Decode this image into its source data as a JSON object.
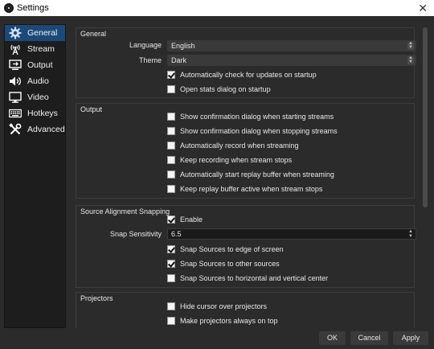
{
  "window": {
    "title": "Settings",
    "close_glyph": "✕",
    "app_icon": "obs-logo-icon"
  },
  "sidebar": {
    "items": [
      {
        "label": "General",
        "icon": "gear-icon",
        "active": true
      },
      {
        "label": "Stream",
        "icon": "broadcast-antenna-icon",
        "active": false
      },
      {
        "label": "Output",
        "icon": "output-icon",
        "active": false
      },
      {
        "label": "Audio",
        "icon": "speaker-icon",
        "active": false
      },
      {
        "label": "Video",
        "icon": "monitor-icon",
        "active": false
      },
      {
        "label": "Hotkeys",
        "icon": "keyboard-icon",
        "active": false
      },
      {
        "label": "Advanced",
        "icon": "tools-icon",
        "active": false
      }
    ]
  },
  "general": {
    "title": "General",
    "language_label": "Language",
    "language_value": "English",
    "theme_label": "Theme",
    "theme_value": "Dark",
    "auto_update_label": "Automatically check for updates on startup",
    "auto_update_checked": true,
    "stats_dialog_label": "Open stats dialog on startup",
    "stats_dialog_checked": false
  },
  "output": {
    "title": "Output",
    "options": [
      {
        "label": "Show confirmation dialog when starting streams",
        "checked": false
      },
      {
        "label": "Show confirmation dialog when stopping streams",
        "checked": false
      },
      {
        "label": "Automatically record when streaming",
        "checked": false
      },
      {
        "label": "Keep recording when stream stops",
        "checked": false
      },
      {
        "label": "Automatically start replay buffer when streaming",
        "checked": false
      },
      {
        "label": "Keep replay buffer active when stream stops",
        "checked": false
      }
    ]
  },
  "snapping": {
    "title": "Source Alignment Snapping",
    "enable_label": "Enable",
    "enable_checked": true,
    "sensitivity_label": "Snap Sensitivity",
    "sensitivity_value": "6.5",
    "options": [
      {
        "label": "Snap Sources to edge of screen",
        "checked": true
      },
      {
        "label": "Snap Sources to other sources",
        "checked": true
      },
      {
        "label": "Snap Sources to horizontal and vertical center",
        "checked": false
      }
    ]
  },
  "projectors": {
    "title": "Projectors",
    "options": [
      {
        "label": "Hide cursor over projectors",
        "checked": false
      },
      {
        "label": "Make projectors always on top",
        "checked": false
      }
    ]
  },
  "buttons": {
    "ok": "OK",
    "cancel": "Cancel",
    "apply": "Apply"
  },
  "colors": {
    "accent": "#1b4a7a",
    "background": "#2b2b2b",
    "sidebar": "#1d1d1d",
    "input": "#3a3a3a"
  }
}
